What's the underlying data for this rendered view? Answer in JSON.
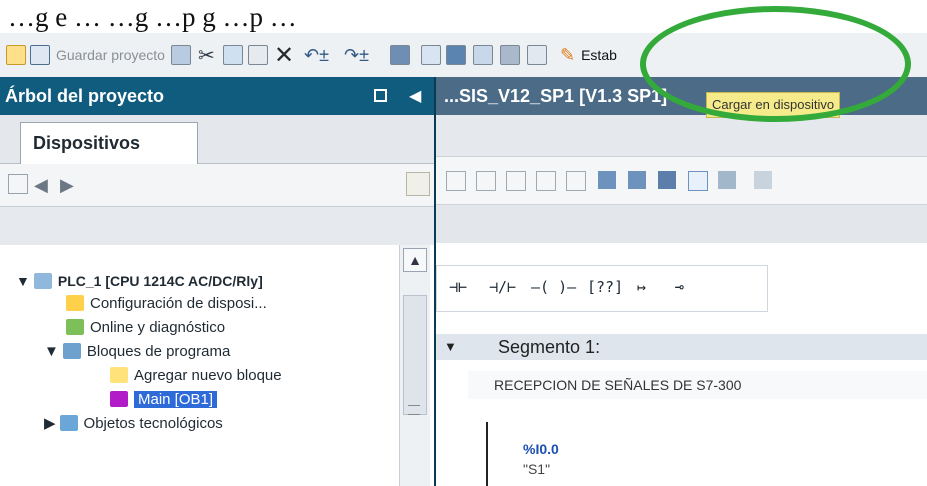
{
  "page": {
    "top_text": "…g e … …g …p g …p …"
  },
  "toolbar": {
    "save_label": "Guardar proyecto",
    "establish_label": "Estab"
  },
  "tooltip": "Cargar en dispositivo",
  "left_panel": {
    "title": "Árbol del proyecto",
    "tab": "Dispositivos",
    "tree": [
      "PLC_1 [CPU 1214C AC/DC/Rly]",
      "Configuración de disposi...",
      "Online y diagnóstico",
      "Bloques de programa",
      "Agregar nuevo bloque",
      "Main [OB1]",
      "Objetos tecnológicos"
    ]
  },
  "right_panel": {
    "title": "...SIS_V12_SP1 [V1.3 SP1]"
  },
  "ladder": {
    "symbols": [
      "⊣⊢",
      "⊣/⊢",
      "–( )–",
      "[??]",
      "↦",
      "⊸"
    ],
    "segment_title": "Segmento 1:",
    "comment": "RECEPCION DE SEÑALES DE S7-300",
    "address": "%I0.0",
    "tag": "\"S1\""
  },
  "colors": {
    "left_header": "#0f5c7f",
    "right_header": "#4b6b86",
    "tooltip_bg": "#f6eb8a",
    "highlight_circle": "#33aa3a",
    "selected_item_bg": "#2f6bd8"
  },
  "icons": {
    "new": "new-project-icon",
    "save": "save-icon",
    "print": "print-icon",
    "cut": "cut-icon",
    "copy": "copy-icon",
    "paste": "paste-icon",
    "delete": "delete-icon",
    "undo": "undo-icon",
    "redo": "redo-icon",
    "download": "download-to-device-icon",
    "establish": "establish-online-icon"
  }
}
